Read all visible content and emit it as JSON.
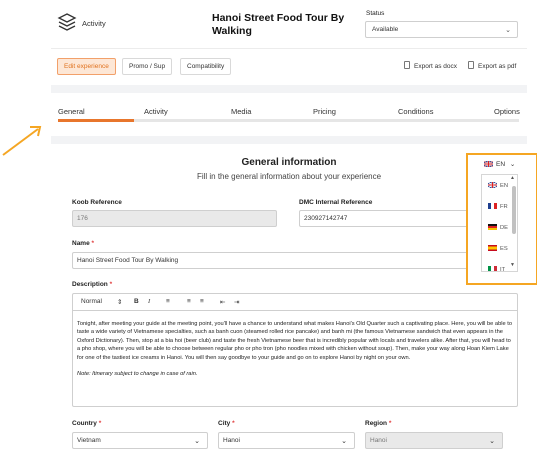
{
  "header": {
    "section_label": "Activity",
    "title": "Hanoi Street Food Tour By Walking",
    "status_label": "Status",
    "status_value": "Available"
  },
  "toolbar": {
    "edit_experience": "Edit experience",
    "promo_sup": "Promo / Sup",
    "compatibility": "Compatibility",
    "export_docx": "Export as docx",
    "export_pdf": "Export as pdf"
  },
  "tabs": [
    {
      "label": "General",
      "active": true
    },
    {
      "label": "Activity",
      "active": false
    },
    {
      "label": "Media",
      "active": false
    },
    {
      "label": "Pricing",
      "active": false
    },
    {
      "label": "Conditions",
      "active": false
    },
    {
      "label": "Options",
      "active": false
    }
  ],
  "general": {
    "title": "General information",
    "subtitle": "Fill in the general information about your experience"
  },
  "fields": {
    "koob_label": "Koob Reference",
    "koob_value": "176",
    "dmc_label": "DMC Internal Reference",
    "dmc_value": "230927142747",
    "name_label": "Name",
    "name_value": "Hanoi Street Food Tour By Walking",
    "description_label": "Description",
    "country_label": "Country",
    "country_value": "Vietnam",
    "city_label": "City",
    "city_value": "Hanoi",
    "region_label": "Region",
    "region_value": "Hanoi",
    "required_mark": "*"
  },
  "editor": {
    "format_select": "Normal",
    "bold": "B",
    "italic": "I",
    "body": "Tonight, after meeting your guide at the meeting point, you'll have a chance to understand what makes Hanoi's Old Quarter such a captivating place. Here, you will be able to taste a wide variety of Vietnamese specialties, such as banh cuon (steamed rolled rice pancake) and banh mi (the famous Vietnamese sandwich that even appears in the Oxford Dictionary). Then, stop at a bia hoi (beer club) and taste the fresh Vietnamese beer that is incredibly popular with locals and travelers alike. After that, you will head to a pho shop, where you will be able to choose between regular pho or pho tron (pho noodles mixed with chicken without soup). Then, make your way along Hoan Kiem Lake for one of the tastiest ice creams in Hanoi. You will then say goodbye to your guide and go on to explore Hanoi by night on your own.",
    "note": "Note: Itinerary subject to change in case of rain."
  },
  "language": {
    "current": "EN",
    "options": [
      {
        "code": "EN",
        "flag": "uk-flag"
      },
      {
        "code": "FR",
        "flag": "france-flag"
      },
      {
        "code": "DE",
        "flag": "germany-flag"
      },
      {
        "code": "ES",
        "flag": "spain-flag"
      },
      {
        "code": "IT",
        "flag": "italy-flag"
      }
    ]
  },
  "colors": {
    "accent": "#e8762c",
    "highlight": "#f5a623"
  }
}
